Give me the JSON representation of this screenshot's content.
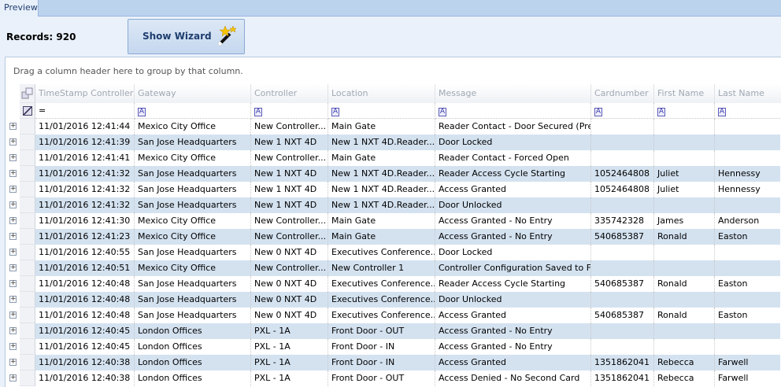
{
  "tab": "Preview",
  "records_label": "Records: 920",
  "wizard_label": "Show Wizard",
  "group_hint": "Drag a column header here to group by that column.",
  "filter_equals": "=",
  "columns": [
    "TimeStamp Controller",
    "Gateway",
    "Controller",
    "Location",
    "Message",
    "Cardnumber",
    "First Name",
    "Last Name"
  ],
  "rows": [
    [
      "11/01/2016 12:41:44",
      "Mexico City Office",
      "New Controller...",
      "Main Gate",
      "Reader Contact - Door Secured (Pre...",
      "",
      "",
      ""
    ],
    [
      "11/01/2016 12:41:39",
      "San Jose Headquarters",
      "New   1 NXT 4D",
      "New   1 NXT 4D.Reader...",
      "Door Locked",
      "",
      "",
      ""
    ],
    [
      "11/01/2016 12:41:41",
      "Mexico City Office",
      "New Controller...",
      "Main Gate",
      "Reader Contact - Forced Open",
      "",
      "",
      ""
    ],
    [
      "11/01/2016 12:41:32",
      "San Jose Headquarters",
      "New   1 NXT 4D",
      "New   1 NXT 4D.Reader...",
      "Reader Access Cycle Starting",
      "1052464808",
      "Juliet",
      "Hennessy"
    ],
    [
      "11/01/2016 12:41:32",
      "San Jose Headquarters",
      "New   1 NXT 4D",
      "New   1 NXT 4D.Reader...",
      "Access Granted",
      "1052464808",
      "Juliet",
      "Hennessy"
    ],
    [
      "11/01/2016 12:41:32",
      "San Jose Headquarters",
      "New   1 NXT 4D",
      "New   1 NXT 4D.Reader...",
      "Door Unlocked",
      "",
      "",
      ""
    ],
    [
      "11/01/2016 12:41:30",
      "Mexico City Office",
      "New Controller...",
      "Main Gate",
      "Access Granted - No Entry",
      "335742328",
      "James",
      "Anderson"
    ],
    [
      "11/01/2016 12:41:23",
      "Mexico City Office",
      "New Controller...",
      "Main Gate",
      "Access Granted - No Entry",
      "540685387",
      "Ronald",
      "Easton"
    ],
    [
      "11/01/2016 12:40:55",
      "San Jose Headquarters",
      "New   0 NXT 4D",
      "Executives Conference...",
      "Door Locked",
      "",
      "",
      ""
    ],
    [
      "11/01/2016 12:40:51",
      "Mexico City Office",
      "New Controller...",
      "New Controller   1",
      "Controller Configuration Saved to Fl...",
      "",
      "",
      ""
    ],
    [
      "11/01/2016 12:40:48",
      "San Jose Headquarters",
      "New   0 NXT 4D",
      "Executives Conference...",
      "Reader Access Cycle Starting",
      "540685387",
      "Ronald",
      "Easton"
    ],
    [
      "11/01/2016 12:40:48",
      "San Jose Headquarters",
      "New   0 NXT 4D",
      "Executives Conference...",
      "Door Unlocked",
      "",
      "",
      ""
    ],
    [
      "11/01/2016 12:40:48",
      "San Jose Headquarters",
      "New   0 NXT 4D",
      "Executives Conference...",
      "Access Granted",
      "540685387",
      "Ronald",
      "Easton"
    ],
    [
      "11/01/2016 12:40:45",
      "London Offices",
      "PXL - 1A",
      "Front Door - OUT",
      "Access Granted - No Entry",
      "",
      "",
      ""
    ],
    [
      "11/01/2016 12:40:45",
      "London Offices",
      "PXL - 1A",
      "Front Door - IN",
      "Access Granted - No Entry",
      "",
      "",
      ""
    ],
    [
      "11/01/2016 12:40:38",
      "London Offices",
      "PXL - 1A",
      "Front Door - IN",
      "Access Granted",
      "1351862041",
      "Rebecca",
      "Farwell"
    ],
    [
      "11/01/2016 12:40:38",
      "London Offices",
      "PXL - 1A",
      "Front Door - OUT",
      "Access Denied - No Second Card",
      "1351862041",
      "Rebecca",
      "Farwell"
    ]
  ]
}
